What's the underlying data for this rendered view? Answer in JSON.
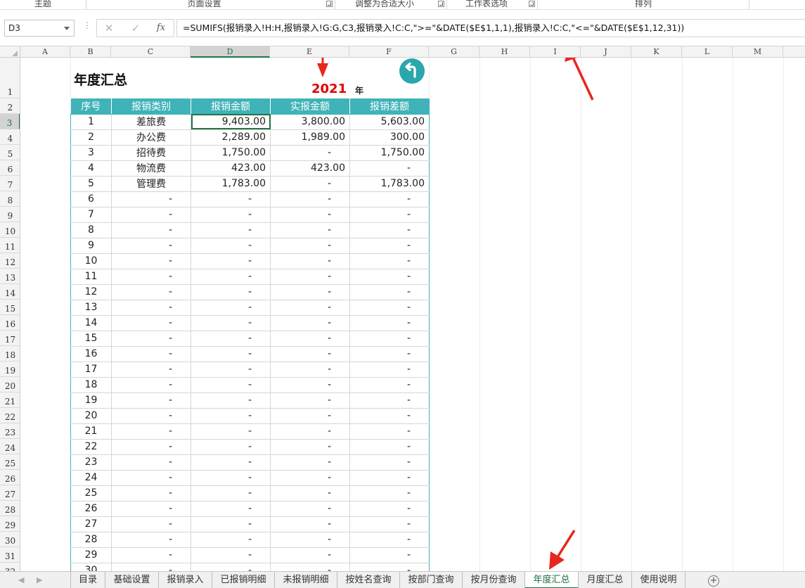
{
  "ribbon": {
    "groups": [
      {
        "label": "主题"
      },
      {
        "label": "页面设置"
      },
      {
        "label": "调整为合适大小"
      },
      {
        "label": "工作表选项"
      },
      {
        "label": "排列"
      }
    ]
  },
  "formula_bar": {
    "name_box": "D3",
    "cancel_icon": "✕",
    "enter_icon": "✓",
    "fx_label": "fx",
    "formula": "=SUMIFS(报销录入!H:H,报销录入!G:G,C3,报销录入!C:C,\">=\"&DATE($E$1,1,1),报销录入!C:C,\"<=\"&DATE($E$1,12,31))"
  },
  "columns": [
    "A",
    "B",
    "C",
    "D",
    "E",
    "F",
    "G",
    "H",
    "I",
    "J",
    "K",
    "L",
    "M"
  ],
  "selected_column": "D",
  "rows": [
    "1",
    "2",
    "3",
    "4",
    "5",
    "6",
    "7",
    "8",
    "9",
    "10",
    "11",
    "12",
    "13",
    "14",
    "15",
    "16",
    "17",
    "18",
    "19",
    "20",
    "21",
    "22",
    "23",
    "24",
    "25",
    "26",
    "27",
    "28",
    "29",
    "30",
    "31",
    "32"
  ],
  "selected_row": "3",
  "sheet": {
    "title": "年度汇总",
    "year": "2021",
    "year_unit": "年",
    "back_icon": "return-arrow-icon",
    "accent_color": "#3fb3b8",
    "header": [
      "序号",
      "报销类别",
      "报销金额",
      "实报金额",
      "报销差额"
    ],
    "data": [
      [
        "1",
        "差旅费",
        "9,403.00",
        "3,800.00",
        "5,603.00"
      ],
      [
        "2",
        "办公费",
        "2,289.00",
        "1,989.00",
        "300.00"
      ],
      [
        "3",
        "招待费",
        "1,750.00",
        "-",
        "1,750.00"
      ],
      [
        "4",
        "物流费",
        "423.00",
        "423.00",
        "-"
      ],
      [
        "5",
        "管理费",
        "1,783.00",
        "-",
        "1,783.00"
      ],
      [
        "6",
        "-",
        "-",
        "-",
        "-"
      ],
      [
        "7",
        "-",
        "-",
        "-",
        "-"
      ],
      [
        "8",
        "-",
        "-",
        "-",
        "-"
      ],
      [
        "9",
        "-",
        "-",
        "-",
        "-"
      ],
      [
        "10",
        "-",
        "-",
        "-",
        "-"
      ],
      [
        "11",
        "-",
        "-",
        "-",
        "-"
      ],
      [
        "12",
        "-",
        "-",
        "-",
        "-"
      ],
      [
        "13",
        "-",
        "-",
        "-",
        "-"
      ],
      [
        "14",
        "-",
        "-",
        "-",
        "-"
      ],
      [
        "15",
        "-",
        "-",
        "-",
        "-"
      ],
      [
        "16",
        "-",
        "-",
        "-",
        "-"
      ],
      [
        "17",
        "-",
        "-",
        "-",
        "-"
      ],
      [
        "18",
        "-",
        "-",
        "-",
        "-"
      ],
      [
        "19",
        "-",
        "-",
        "-",
        "-"
      ],
      [
        "20",
        "-",
        "-",
        "-",
        "-"
      ],
      [
        "21",
        "-",
        "-",
        "-",
        "-"
      ],
      [
        "22",
        "-",
        "-",
        "-",
        "-"
      ],
      [
        "23",
        "-",
        "-",
        "-",
        "-"
      ],
      [
        "24",
        "-",
        "-",
        "-",
        "-"
      ],
      [
        "25",
        "-",
        "-",
        "-",
        "-"
      ],
      [
        "26",
        "-",
        "-",
        "-",
        "-"
      ],
      [
        "27",
        "-",
        "-",
        "-",
        "-"
      ],
      [
        "28",
        "-",
        "-",
        "-",
        "-"
      ],
      [
        "29",
        "-",
        "-",
        "-",
        "-"
      ],
      [
        "30",
        "-",
        "-",
        "-",
        "-"
      ]
    ]
  },
  "tabs": [
    {
      "label": "目录",
      "active": false
    },
    {
      "label": "基础设置",
      "active": false
    },
    {
      "label": "报销录入",
      "active": false
    },
    {
      "label": "已报销明细",
      "active": false
    },
    {
      "label": "未报销明细",
      "active": false
    },
    {
      "label": "按姓名查询",
      "active": false
    },
    {
      "label": "按部门查询",
      "active": false
    },
    {
      "label": "按月份查询",
      "active": false
    },
    {
      "label": "年度汇总",
      "active": true
    },
    {
      "label": "月度汇总",
      "active": false
    },
    {
      "label": "使用说明",
      "active": false
    }
  ],
  "add_tab_icon": "+"
}
